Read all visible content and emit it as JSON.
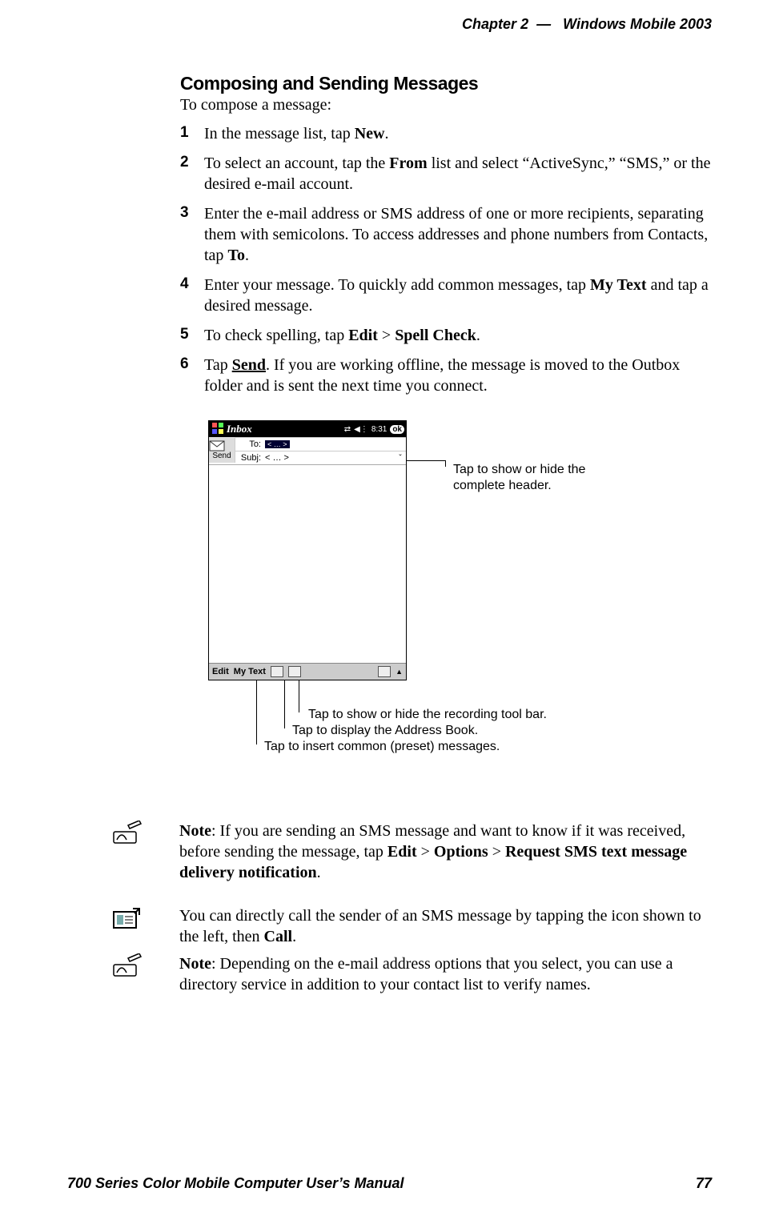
{
  "header": {
    "chapter_label": "Chapter",
    "chapter_number": "2",
    "dash": "—",
    "product": "Windows Mobile 2003"
  },
  "section": {
    "title": "Composing and Sending Messages",
    "intro": "To compose a message:"
  },
  "steps": [
    {
      "num": "1",
      "pre": "In the message list, tap ",
      "b1": "New",
      "post": "."
    },
    {
      "num": "2",
      "pre": "To select an account, tap the ",
      "b1": "From",
      "post": " list and select “ActiveSync,” “SMS,” or the desired e-mail account."
    },
    {
      "num": "3",
      "pre": "Enter the e-mail address or SMS address of one or more recipients, separating them with semicolons. To access addresses and phone numbers from Contacts, tap ",
      "b1": "To",
      "post": "."
    },
    {
      "num": "4",
      "pre": "Enter your message. To quickly add common messages, tap ",
      "b1": "My Text",
      "post_pre": " and tap a desired message.",
      "post": ""
    },
    {
      "num": "5",
      "pre": "To check spelling, tap ",
      "b1": "Edit",
      "mid": " > ",
      "b2": "Spell Check",
      "post": "."
    },
    {
      "num": "6",
      "pre": "Tap ",
      "b1": "Send",
      "post": ". If you are working offline, the message is moved to the Outbox folder and is sent the next time you connect."
    }
  ],
  "device": {
    "title": "Inbox",
    "time": "8:31",
    "ok": "ok",
    "send_label": "Send",
    "to_label": "To:",
    "to_value": "< … >",
    "subj_label": "Subj:",
    "subj_value": "< … >",
    "bottom_edit": "Edit",
    "bottom_mytext": "My Text"
  },
  "callouts": {
    "header_toggle": "Tap to show or hide the complete header.",
    "recording": "Tap to show or hide the recording tool bar.",
    "address_book": "Tap to display the Address Book.",
    "preset": "Tap to insert common (preset) messages."
  },
  "notes": {
    "n1_pre": "Note",
    "n1_body_a": ": If you are sending an SMS message and want to know if it was received, before sending the message, tap ",
    "n1_b1": "Edit",
    "n1_mid1": " > ",
    "n1_b2": "Options",
    "n1_mid2": " > ",
    "n1_b3": "Request SMS text message delivery notification",
    "n1_post": ".",
    "n2_a": "You can directly call the sender of an SMS message by tapping the icon shown to the left, then ",
    "n2_b1": "Call",
    "n2_post": ".",
    "n3_pre": "Note",
    "n3_body": ": Depending on the e-mail address options that you select, you can use a directory service in addition to your contact list to verify names."
  },
  "footer": {
    "left": "700 Series Color Mobile Computer User’s Manual",
    "right": "77"
  }
}
